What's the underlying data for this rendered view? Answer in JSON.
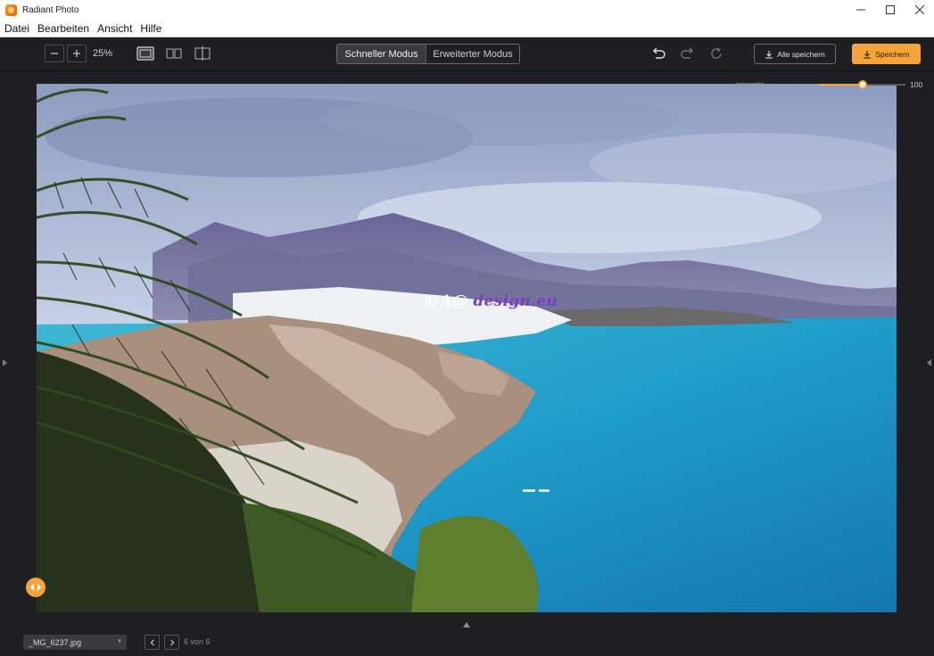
{
  "window": {
    "title": "Radiant Photo"
  },
  "menu": {
    "items": [
      "Datei",
      "Bearbeiten",
      "Ansicht",
      "Hilfe"
    ]
  },
  "toolbar": {
    "zoom_level": "25%",
    "modes": {
      "quick": "Schneller Modus",
      "advanced": "Erweiterter Modus"
    },
    "save_all_label": "Alle speichern",
    "save_label": "Speichern"
  },
  "intensity": {
    "label": "Intensität",
    "value": "100",
    "level": 0.5
  },
  "photo": {
    "watermark_white": "@A@",
    "watermark_purple": "design.eu"
  },
  "footer": {
    "file_name": "_MG_6237.jpg",
    "page_status": "6 von 6"
  },
  "colors": {
    "accent": "#f4a43b",
    "background": "#1f1f23",
    "watermark": "#7b3fc4"
  }
}
